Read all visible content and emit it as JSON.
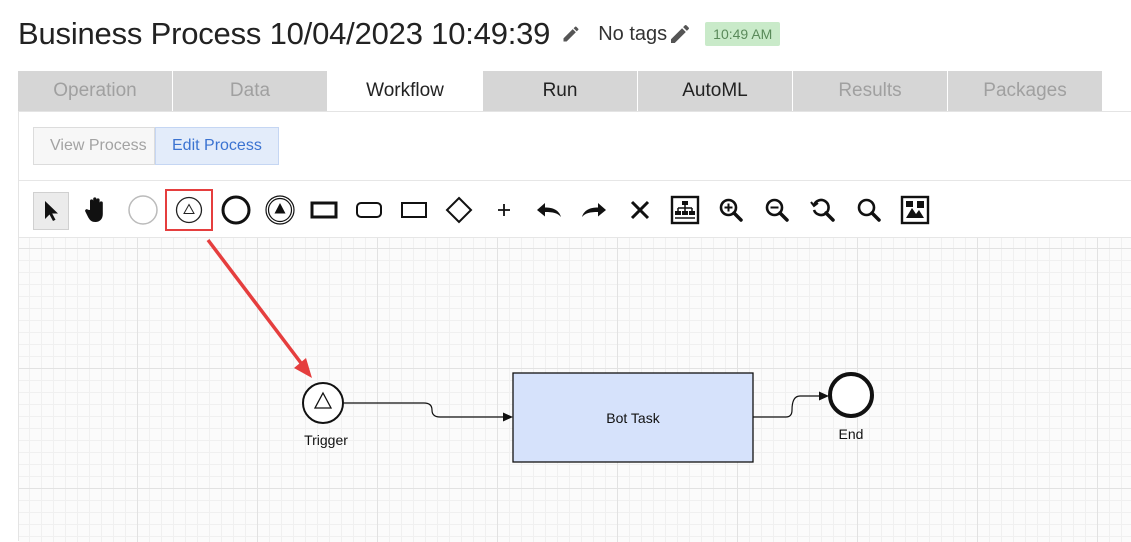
{
  "header": {
    "title": "Business Process 10/04/2023 10:49:39",
    "tags_label": "No tags",
    "time_badge": "10:49 AM"
  },
  "tabs": [
    {
      "label": "Operation",
      "state": "disabled"
    },
    {
      "label": "Data",
      "state": "disabled"
    },
    {
      "label": "Workflow",
      "state": "active"
    },
    {
      "label": "Run",
      "state": "enabled"
    },
    {
      "label": "AutoML",
      "state": "enabled"
    },
    {
      "label": "Results",
      "state": "disabled"
    },
    {
      "label": "Packages",
      "state": "disabled"
    }
  ],
  "modes": {
    "view": "View Process",
    "edit": "Edit Process",
    "selected": "Edit Process"
  },
  "toolbar": {
    "tools": [
      "pointer-icon",
      "hand-icon",
      "start-event-icon",
      "conditional-start-event-icon",
      "end-event-icon",
      "signal-event-icon",
      "task-icon",
      "subprocess-icon",
      "rectangle-icon",
      "gateway-icon",
      "plus-icon",
      "undo-icon",
      "redo-icon",
      "delete-icon",
      "auto-layout-icon",
      "zoom-in-icon",
      "zoom-out-icon",
      "zoom-reset-icon",
      "zoom-fit-icon",
      "export-image-icon"
    ],
    "highlighted_tool": "conditional-start-event-icon",
    "annotation_color": "#e53e3e"
  },
  "diagram": {
    "nodes": {
      "trigger": "Trigger",
      "bot_task": "Bot Task",
      "end": "End"
    },
    "task_fill": "#d6e2fb"
  }
}
